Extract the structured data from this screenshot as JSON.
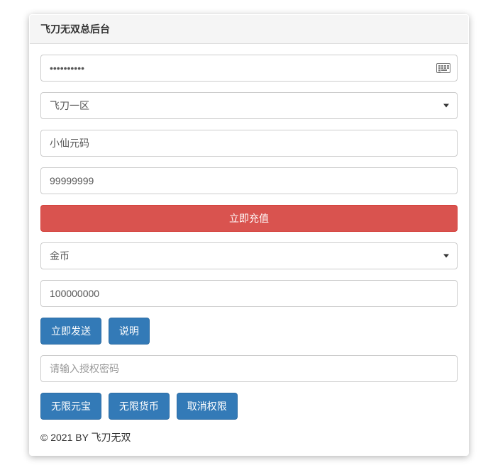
{
  "header": {
    "title": "飞刀无双总后台"
  },
  "form": {
    "password_value": "••••••••••",
    "server_select": "飞刀一区",
    "player_name": "小仙元码",
    "recharge_amount": "99999999",
    "recharge_button": "立即充值",
    "currency_select": "金币",
    "send_amount": "100000000",
    "send_now_button": "立即发送",
    "explain_button": "说明",
    "auth_password_placeholder": "请输入授权密码",
    "unlimited_yuanbao_button": "无限元宝",
    "unlimited_currency_button": "无限货币",
    "cancel_permission_button": "取消权限"
  },
  "footer": {
    "copyright": "© 2021 BY 飞刀无双"
  }
}
